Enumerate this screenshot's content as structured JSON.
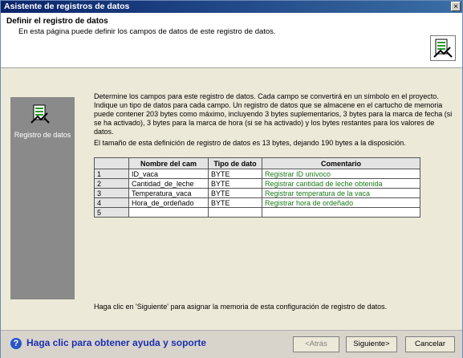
{
  "window": {
    "title": "Asistente de registros de datos",
    "close_glyph": "×"
  },
  "header": {
    "title": "Definir el registro de datos",
    "subtitle": "En esta página puede definir los campos de datos de este registro de datos."
  },
  "sidebar": {
    "label": "Registro de datos"
  },
  "content": {
    "paragraph": "Determine los campos para este registro de datos. Cada campo se convertirá en un símbolo en el proyecto. Indique un tipo de datos para cada campo. Un registro de datos que se almacene en el cartucho de memoria puede contener 203 bytes como máximo, incluyendo 3 bytes suplementarios, 3 bytes para la marca de fecha (si se ha activado), 3 bytes para la marca de hora (si se ha activado) y los bytes restantes para los valores de datos.",
    "size_text": "El tamaño de esta definición de registro de datos es 13 bytes, dejando 190 bytes a la disposición.",
    "footer_text": "Haga clic en 'Siguiente' para asignar la memoria de esta configuración de registro de datos."
  },
  "table": {
    "headers": [
      "",
      "Nombre del cam",
      "Tipo de dato",
      "Comentario"
    ],
    "rows": [
      {
        "num": "1",
        "name": "ID_vaca",
        "type": "BYTE",
        "comment": "Registrar ID unívoco"
      },
      {
        "num": "2",
        "name": "Cantidad_de_leche",
        "type": "BYTE",
        "comment": "Registrar cantidad de leche obtenida"
      },
      {
        "num": "3",
        "name": "Temperatura_vaca",
        "type": "BYTE",
        "comment": "Registrar temperatura de la vaca"
      },
      {
        "num": "4",
        "name": "Hora_de_ordeñado",
        "type": "BYTE",
        "comment": "Registrar hora de ordeñado"
      },
      {
        "num": "5",
        "name": "",
        "type": "",
        "comment": ""
      }
    ]
  },
  "bottom": {
    "help_text": "Haga clic para obtener ayuda y soporte",
    "back_label": "<Atrás",
    "next_label": "Siguiente>",
    "cancel_label": "Cancelar"
  },
  "colors": {
    "title_bar": "#0a246a",
    "comment_text": "#1a7a1a",
    "help_link": "#1b2fb0"
  },
  "icons": {
    "header": "data-log-wizard-icon",
    "sidebar": "data-log-icon",
    "help": "help-question-icon"
  }
}
